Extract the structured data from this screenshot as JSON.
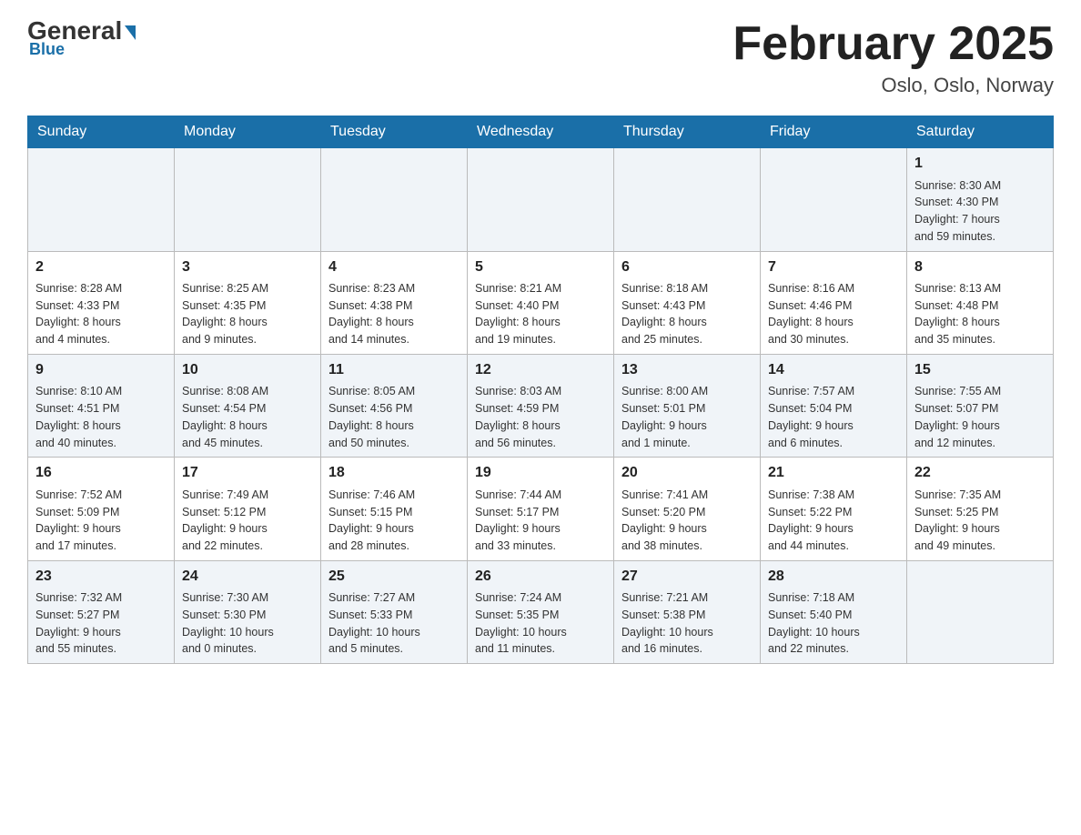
{
  "logo": {
    "general": "General",
    "triangle": "▶",
    "blue": "Blue"
  },
  "header": {
    "month_title": "February 2025",
    "location": "Oslo, Oslo, Norway"
  },
  "days_of_week": [
    "Sunday",
    "Monday",
    "Tuesday",
    "Wednesday",
    "Thursday",
    "Friday",
    "Saturday"
  ],
  "weeks": [
    {
      "days": [
        {
          "num": "",
          "info": ""
        },
        {
          "num": "",
          "info": ""
        },
        {
          "num": "",
          "info": ""
        },
        {
          "num": "",
          "info": ""
        },
        {
          "num": "",
          "info": ""
        },
        {
          "num": "",
          "info": ""
        },
        {
          "num": "1",
          "info": "Sunrise: 8:30 AM\nSunset: 4:30 PM\nDaylight: 7 hours\nand 59 minutes."
        }
      ]
    },
    {
      "days": [
        {
          "num": "2",
          "info": "Sunrise: 8:28 AM\nSunset: 4:33 PM\nDaylight: 8 hours\nand 4 minutes."
        },
        {
          "num": "3",
          "info": "Sunrise: 8:25 AM\nSunset: 4:35 PM\nDaylight: 8 hours\nand 9 minutes."
        },
        {
          "num": "4",
          "info": "Sunrise: 8:23 AM\nSunset: 4:38 PM\nDaylight: 8 hours\nand 14 minutes."
        },
        {
          "num": "5",
          "info": "Sunrise: 8:21 AM\nSunset: 4:40 PM\nDaylight: 8 hours\nand 19 minutes."
        },
        {
          "num": "6",
          "info": "Sunrise: 8:18 AM\nSunset: 4:43 PM\nDaylight: 8 hours\nand 25 minutes."
        },
        {
          "num": "7",
          "info": "Sunrise: 8:16 AM\nSunset: 4:46 PM\nDaylight: 8 hours\nand 30 minutes."
        },
        {
          "num": "8",
          "info": "Sunrise: 8:13 AM\nSunset: 4:48 PM\nDaylight: 8 hours\nand 35 minutes."
        }
      ]
    },
    {
      "days": [
        {
          "num": "9",
          "info": "Sunrise: 8:10 AM\nSunset: 4:51 PM\nDaylight: 8 hours\nand 40 minutes."
        },
        {
          "num": "10",
          "info": "Sunrise: 8:08 AM\nSunset: 4:54 PM\nDaylight: 8 hours\nand 45 minutes."
        },
        {
          "num": "11",
          "info": "Sunrise: 8:05 AM\nSunset: 4:56 PM\nDaylight: 8 hours\nand 50 minutes."
        },
        {
          "num": "12",
          "info": "Sunrise: 8:03 AM\nSunset: 4:59 PM\nDaylight: 8 hours\nand 56 minutes."
        },
        {
          "num": "13",
          "info": "Sunrise: 8:00 AM\nSunset: 5:01 PM\nDaylight: 9 hours\nand 1 minute."
        },
        {
          "num": "14",
          "info": "Sunrise: 7:57 AM\nSunset: 5:04 PM\nDaylight: 9 hours\nand 6 minutes."
        },
        {
          "num": "15",
          "info": "Sunrise: 7:55 AM\nSunset: 5:07 PM\nDaylight: 9 hours\nand 12 minutes."
        }
      ]
    },
    {
      "days": [
        {
          "num": "16",
          "info": "Sunrise: 7:52 AM\nSunset: 5:09 PM\nDaylight: 9 hours\nand 17 minutes."
        },
        {
          "num": "17",
          "info": "Sunrise: 7:49 AM\nSunset: 5:12 PM\nDaylight: 9 hours\nand 22 minutes."
        },
        {
          "num": "18",
          "info": "Sunrise: 7:46 AM\nSunset: 5:15 PM\nDaylight: 9 hours\nand 28 minutes."
        },
        {
          "num": "19",
          "info": "Sunrise: 7:44 AM\nSunset: 5:17 PM\nDaylight: 9 hours\nand 33 minutes."
        },
        {
          "num": "20",
          "info": "Sunrise: 7:41 AM\nSunset: 5:20 PM\nDaylight: 9 hours\nand 38 minutes."
        },
        {
          "num": "21",
          "info": "Sunrise: 7:38 AM\nSunset: 5:22 PM\nDaylight: 9 hours\nand 44 minutes."
        },
        {
          "num": "22",
          "info": "Sunrise: 7:35 AM\nSunset: 5:25 PM\nDaylight: 9 hours\nand 49 minutes."
        }
      ]
    },
    {
      "days": [
        {
          "num": "23",
          "info": "Sunrise: 7:32 AM\nSunset: 5:27 PM\nDaylight: 9 hours\nand 55 minutes."
        },
        {
          "num": "24",
          "info": "Sunrise: 7:30 AM\nSunset: 5:30 PM\nDaylight: 10 hours\nand 0 minutes."
        },
        {
          "num": "25",
          "info": "Sunrise: 7:27 AM\nSunset: 5:33 PM\nDaylight: 10 hours\nand 5 minutes."
        },
        {
          "num": "26",
          "info": "Sunrise: 7:24 AM\nSunset: 5:35 PM\nDaylight: 10 hours\nand 11 minutes."
        },
        {
          "num": "27",
          "info": "Sunrise: 7:21 AM\nSunset: 5:38 PM\nDaylight: 10 hours\nand 16 minutes."
        },
        {
          "num": "28",
          "info": "Sunrise: 7:18 AM\nSunset: 5:40 PM\nDaylight: 10 hours\nand 22 minutes."
        },
        {
          "num": "",
          "info": ""
        }
      ]
    }
  ]
}
